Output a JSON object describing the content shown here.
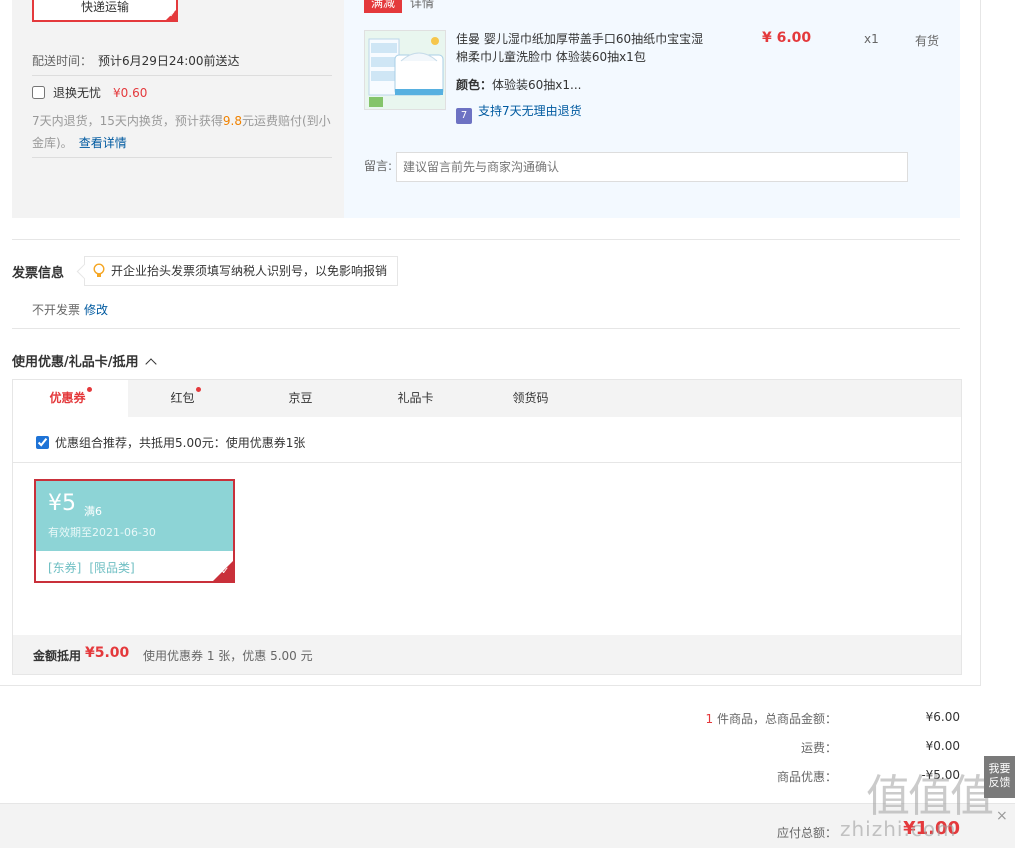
{
  "shipping": {
    "method": "快递运输",
    "time_label": "配送时间：",
    "time_value": "预计6月29日24:00前送达",
    "worry_free_label": "退换无忧",
    "worry_free_price": "¥0.60",
    "worry_desc_prefix": "7天内退货，15天内换货，预计获得",
    "worry_desc_amount": "9.8",
    "worry_desc_suffix": "元运费赔付(到小金库)。",
    "details_link": "查看详情"
  },
  "goods": {
    "promo_tag": "满减",
    "promo_detail": "详情",
    "name": "佳曼 婴儿湿巾纸加厚带盖手口60抽纸巾宝宝湿棉柔巾儿童洗脸巾 体验装60抽x1包",
    "color_label": "颜色：",
    "color_value": "体验装60抽x1...",
    "seven_icon": "7",
    "seven_days": "支持7天无理由退货",
    "price": "¥ 6.00",
    "qty": "x1",
    "stock": "有货",
    "message_label": "留言:",
    "message_placeholder": "建议留言前先与商家沟通确认"
  },
  "invoice": {
    "title": "发票信息",
    "tip": "开企业抬头发票须填写纳税人识别号，以免影响报销",
    "value": "不开发票",
    "edit": "修改"
  },
  "coupons": {
    "title": "使用优惠/礼品卡/抵用",
    "tabs": [
      {
        "label": "优惠券",
        "dot": true,
        "active": true
      },
      {
        "label": "红包",
        "dot": true,
        "active": false
      },
      {
        "label": "京豆",
        "dot": false,
        "active": false
      },
      {
        "label": "礼品卡",
        "dot": false,
        "active": false
      },
      {
        "label": "领货码",
        "dot": false,
        "active": false
      }
    ],
    "combo_text": "优惠组合推荐，共抵用5.00元：使用优惠券1张",
    "coupon": {
      "amount": "¥5",
      "condition": "满6",
      "expiry": "有效期至2021-06-30",
      "tag1": "[东券]",
      "tag2": "[限品类]"
    },
    "summary_label": "金额抵用",
    "summary_value": "¥5.00",
    "summary_desc": "使用优惠券 1 张，优惠 5.00 元"
  },
  "totals": {
    "count": "1",
    "count_label": "件商品，总商品金额：",
    "goods_total": "¥6.00",
    "freight_label": "运费：",
    "freight": "¥0.00",
    "discount_label": "商品优惠：",
    "discount": "-¥5.00",
    "payable_label": "应付总额：",
    "payable": "¥1.00"
  },
  "side": {
    "feedback": "我要反馈",
    "close": "×"
  },
  "watermark": {
    "logo": "值值值",
    "url": "zhizhi.com"
  },
  "colors": {
    "accent": "#e4393c",
    "link": "#005aa0",
    "coupon": "#8dd4d6"
  }
}
